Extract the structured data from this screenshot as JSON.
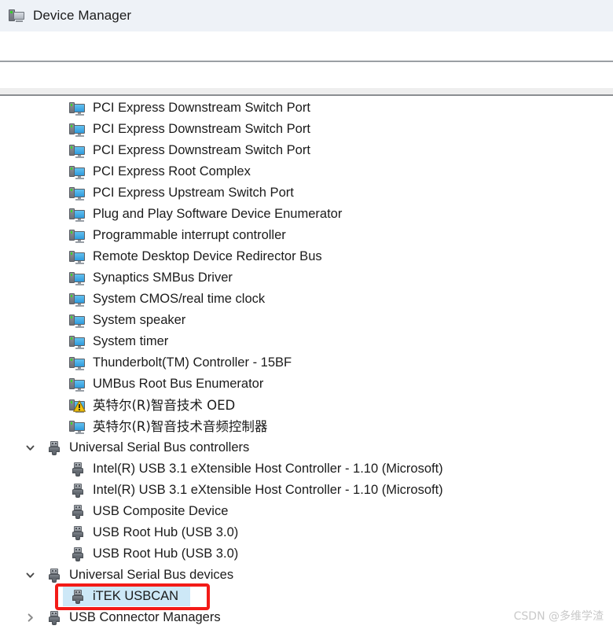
{
  "window": {
    "title": "Device Manager",
    "icon": "device-manager-icon"
  },
  "colors": {
    "titlebar_bg": "#eef2f7",
    "selection_bg": "#cde8f7",
    "annotation_red": "#f31b17",
    "device_icon_blue": "#2f9bdc",
    "warning_yellow": "#f2c20c",
    "watermark_gray": "#c9c9c9"
  },
  "tree": {
    "rows": [
      {
        "label": "PCI Express Downstream Switch Port",
        "icon": "device-icon",
        "indent": 2,
        "chevron": "none",
        "selected": false,
        "warning": false
      },
      {
        "label": "PCI Express Downstream Switch Port",
        "icon": "device-icon",
        "indent": 2,
        "chevron": "none",
        "selected": false,
        "warning": false
      },
      {
        "label": "PCI Express Downstream Switch Port",
        "icon": "device-icon",
        "indent": 2,
        "chevron": "none",
        "selected": false,
        "warning": false
      },
      {
        "label": "PCI Express Root Complex",
        "icon": "device-icon",
        "indent": 2,
        "chevron": "none",
        "selected": false,
        "warning": false
      },
      {
        "label": "PCI Express Upstream Switch Port",
        "icon": "device-icon",
        "indent": 2,
        "chevron": "none",
        "selected": false,
        "warning": false
      },
      {
        "label": "Plug and Play Software Device Enumerator",
        "icon": "device-icon",
        "indent": 2,
        "chevron": "none",
        "selected": false,
        "warning": false
      },
      {
        "label": "Programmable interrupt controller",
        "icon": "device-icon",
        "indent": 2,
        "chevron": "none",
        "selected": false,
        "warning": false
      },
      {
        "label": "Remote Desktop Device Redirector Bus",
        "icon": "device-icon",
        "indent": 2,
        "chevron": "none",
        "selected": false,
        "warning": false
      },
      {
        "label": "Synaptics SMBus Driver",
        "icon": "device-icon",
        "indent": 2,
        "chevron": "none",
        "selected": false,
        "warning": false
      },
      {
        "label": "System CMOS/real time clock",
        "icon": "device-icon",
        "indent": 2,
        "chevron": "none",
        "selected": false,
        "warning": false
      },
      {
        "label": "System speaker",
        "icon": "device-icon",
        "indent": 2,
        "chevron": "none",
        "selected": false,
        "warning": false
      },
      {
        "label": "System timer",
        "icon": "device-icon",
        "indent": 2,
        "chevron": "none",
        "selected": false,
        "warning": false
      },
      {
        "label": "Thunderbolt(TM) Controller - 15BF",
        "icon": "device-icon",
        "indent": 2,
        "chevron": "none",
        "selected": false,
        "warning": false
      },
      {
        "label": "UMBus Root Bus Enumerator",
        "icon": "device-icon",
        "indent": 2,
        "chevron": "none",
        "selected": false,
        "warning": false
      },
      {
        "label": "英特尔(R)智音技术 OED",
        "icon": "device-icon",
        "indent": 2,
        "chevron": "none",
        "selected": false,
        "warning": true,
        "cjk": true
      },
      {
        "label": "英特尔(R)智音技术音频控制器",
        "icon": "device-icon",
        "indent": 2,
        "chevron": "none",
        "selected": false,
        "warning": false,
        "cjk": true
      },
      {
        "label": "Universal Serial Bus controllers",
        "icon": "usb-icon",
        "indent": 1,
        "chevron": "expanded",
        "selected": false,
        "warning": false
      },
      {
        "label": "Intel(R) USB 3.1 eXtensible Host Controller - 1.10 (Microsoft)",
        "icon": "usb-icon",
        "indent": 2,
        "chevron": "none",
        "selected": false,
        "warning": false
      },
      {
        "label": "Intel(R) USB 3.1 eXtensible Host Controller - 1.10 (Microsoft)",
        "icon": "usb-icon",
        "indent": 2,
        "chevron": "none",
        "selected": false,
        "warning": false
      },
      {
        "label": "USB Composite Device",
        "icon": "usb-icon",
        "indent": 2,
        "chevron": "none",
        "selected": false,
        "warning": false
      },
      {
        "label": "USB Root Hub (USB 3.0)",
        "icon": "usb-icon",
        "indent": 2,
        "chevron": "none",
        "selected": false,
        "warning": false
      },
      {
        "label": "USB Root Hub (USB 3.0)",
        "icon": "usb-icon",
        "indent": 2,
        "chevron": "none",
        "selected": false,
        "warning": false
      },
      {
        "label": "Universal Serial Bus devices",
        "icon": "usb-icon",
        "indent": 1,
        "chevron": "expanded",
        "selected": false,
        "warning": false
      },
      {
        "label": "iTEK USBCAN",
        "icon": "usb-icon",
        "indent": 2,
        "chevron": "none",
        "selected": true,
        "warning": false
      },
      {
        "label": "USB Connector Managers",
        "icon": "usb-icon",
        "indent": 1,
        "chevron": "collapsed",
        "selected": false,
        "warning": false
      }
    ]
  },
  "annotation": {
    "type": "red-rectangle",
    "target_label": "iTEK USBCAN"
  },
  "watermark": {
    "text": "CSDN @多维学渣"
  }
}
